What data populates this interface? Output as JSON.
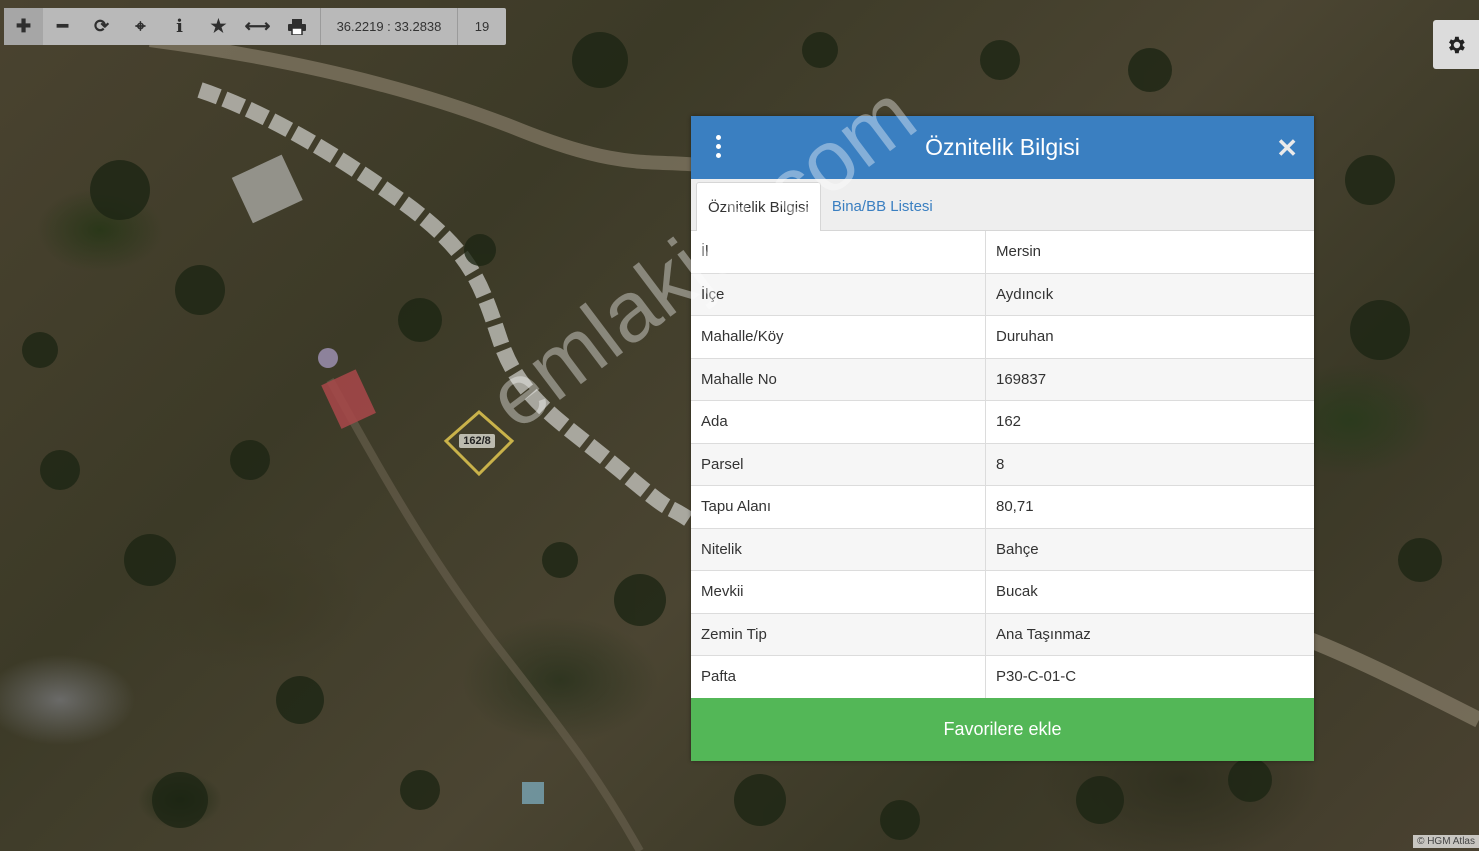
{
  "toolbar": {
    "buttons": [
      {
        "name": "zoom-in-button",
        "icon": "plus-icon",
        "glyph": "✚"
      },
      {
        "name": "zoom-out-button",
        "icon": "minus-icon",
        "glyph": "━"
      },
      {
        "name": "refresh-button",
        "icon": "refresh-icon",
        "glyph": "⟳"
      },
      {
        "name": "locate-button",
        "icon": "crosshair-icon",
        "glyph": "⌖"
      },
      {
        "name": "info-button",
        "icon": "info-icon",
        "glyph": "i"
      },
      {
        "name": "favorite-button",
        "icon": "star-icon",
        "glyph": "★"
      },
      {
        "name": "measure-button",
        "icon": "arrows-horizontal-icon",
        "glyph": "⟷"
      },
      {
        "name": "print-button",
        "icon": "printer-icon",
        "glyph": "⎙"
      }
    ],
    "coordinates": "36.2219 : 33.2838",
    "zoom_level": "19"
  },
  "settings_icon": "gear-icon",
  "map": {
    "parcel_label": "162/8",
    "watermark": "emlakjet.com",
    "attribution": "© HGM Atlas"
  },
  "panel": {
    "title": "Öznitelik Bilgisi",
    "menu_icon": "vertical-dots-icon",
    "close_icon": "close-icon",
    "tabs": [
      {
        "label": "Öznitelik Bilgisi",
        "active": true
      },
      {
        "label": "Bina/BB Listesi",
        "active": false
      }
    ],
    "rows": [
      {
        "key": "İl",
        "value": "Mersin"
      },
      {
        "key": "İlçe",
        "value": "Aydıncık"
      },
      {
        "key": "Mahalle/Köy",
        "value": "Duruhan"
      },
      {
        "key": "Mahalle No",
        "value": "169837"
      },
      {
        "key": "Ada",
        "value": "162"
      },
      {
        "key": "Parsel",
        "value": "8"
      },
      {
        "key": "Tapu Alanı",
        "value": "80,71"
      },
      {
        "key": "Nitelik",
        "value": "Bahçe"
      },
      {
        "key": "Mevkii",
        "value": "Bucak"
      },
      {
        "key": "Zemin Tip",
        "value": "Ana Taşınmaz"
      },
      {
        "key": "Pafta",
        "value": "P30-C-01-C"
      }
    ],
    "favorite_button": "Favorilere ekle"
  },
  "colors": {
    "header_blue": "#3a7fc1",
    "button_green": "#53b757",
    "parcel_outline": "#c9b24a"
  }
}
